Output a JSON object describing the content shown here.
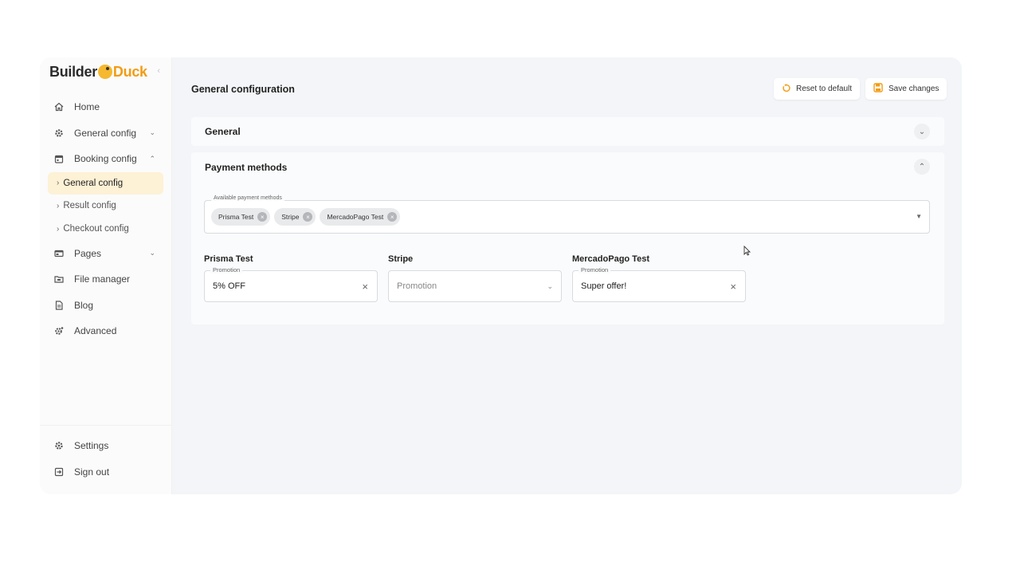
{
  "logo": {
    "part1": "Builder",
    "part2": "Duck"
  },
  "sidebar": {
    "items": [
      {
        "label": "Home",
        "icon": "home-icon"
      },
      {
        "label": "General config",
        "icon": "gear-icon"
      },
      {
        "label": "Booking config",
        "icon": "calendar-icon"
      },
      {
        "label": "Pages",
        "icon": "pages-icon"
      },
      {
        "label": "File manager",
        "icon": "folder-icon"
      },
      {
        "label": "Blog",
        "icon": "document-icon"
      },
      {
        "label": "Advanced",
        "icon": "advanced-gear-icon"
      }
    ],
    "subitems": [
      {
        "label": "General config",
        "active": true
      },
      {
        "label": "Result config"
      },
      {
        "label": "Checkout config"
      }
    ],
    "bottom": [
      {
        "label": "Settings",
        "icon": "gear-icon"
      },
      {
        "label": "Sign out",
        "icon": "sign-out-icon"
      }
    ]
  },
  "header": {
    "title": "General configuration",
    "reset_label": "Reset to default",
    "save_label": "Save changes"
  },
  "panels": {
    "general_title": "General",
    "payment_title": "Payment methods"
  },
  "payment": {
    "available_label": "Available payment methods",
    "chips": [
      "Prisma Test",
      "Stripe",
      "MercadoPago Test"
    ],
    "methods": [
      {
        "name": "Prisma Test",
        "field_label": "Promotion",
        "value": "5% OFF"
      },
      {
        "name": "Stripe",
        "placeholder": "Promotion"
      },
      {
        "name": "MercadoPago Test",
        "field_label": "Promotion",
        "value": "Super offer!"
      }
    ]
  },
  "colors": {
    "accent": "#f39c12",
    "active_bg": "#fdf1d6",
    "app_bg": "#f3f5f8"
  }
}
